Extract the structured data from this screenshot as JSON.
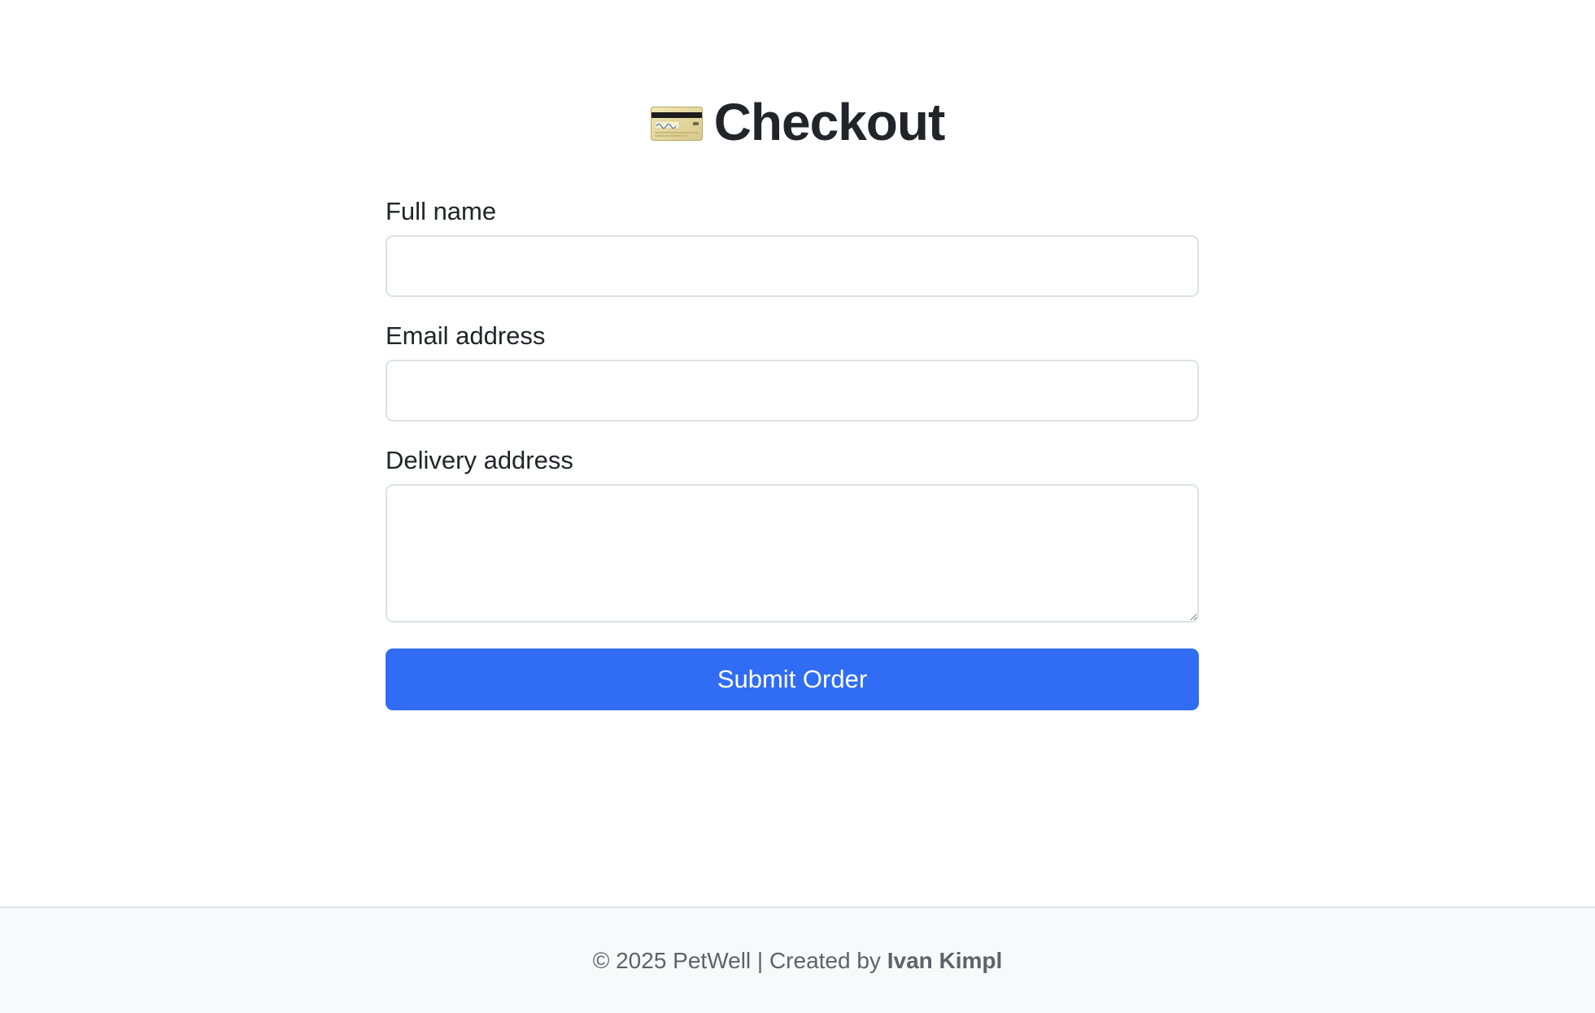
{
  "header": {
    "title": "Checkout",
    "icon": "credit-card-icon"
  },
  "form": {
    "full_name": {
      "label": "Full name",
      "value": "",
      "placeholder": ""
    },
    "email": {
      "label": "Email address",
      "value": "",
      "placeholder": ""
    },
    "delivery_address": {
      "label": "Delivery address",
      "value": "",
      "placeholder": ""
    },
    "submit_label": "Submit Order"
  },
  "footer": {
    "text": "© 2025 PetWell | Created by ",
    "author": "Ivan Kimpl"
  },
  "colors": {
    "primary": "#316df4",
    "text": "#212529",
    "border": "#dee2e6",
    "footer_bg": "#f8f9fa",
    "footer_text": "#5c636a"
  }
}
